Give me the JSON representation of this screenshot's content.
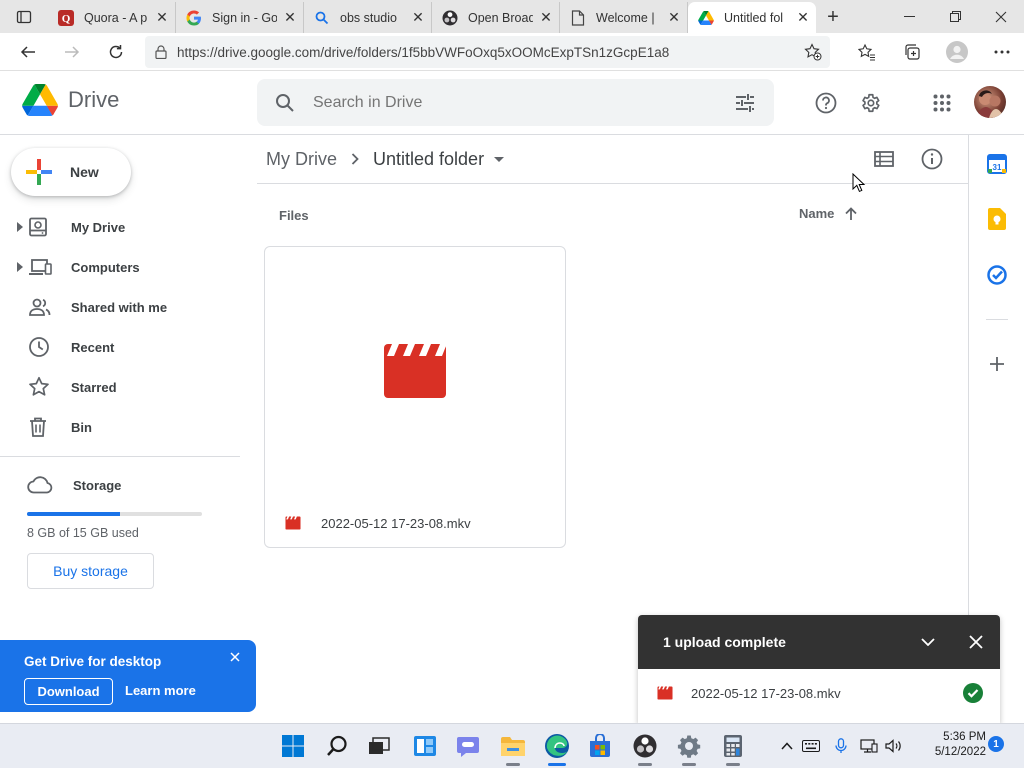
{
  "browser": {
    "tabs": [
      {
        "title": "Quora - A p",
        "icon": "quora-icon"
      },
      {
        "title": "Sign in - Go",
        "icon": "google-icon"
      },
      {
        "title": "obs studio",
        "icon": "search-icon"
      },
      {
        "title": "Open Broad",
        "icon": "obs-icon"
      },
      {
        "title": "Welcome |",
        "icon": "page-icon"
      },
      {
        "title": "Untitled fol",
        "icon": "drive-icon",
        "active": true
      }
    ],
    "url": "https://drive.google.com/drive/folders/1f5bbVWFoOxq5xOOMcExpTSn1zGcpE1a8"
  },
  "drive": {
    "app_name": "Drive",
    "search_placeholder": "Search in Drive",
    "new_label": "New",
    "nav": [
      {
        "label": "My Drive",
        "icon": "my-drive-icon",
        "expandable": true
      },
      {
        "label": "Computers",
        "icon": "computers-icon",
        "expandable": true
      },
      {
        "label": "Shared with me",
        "icon": "shared-icon",
        "expandable": false
      },
      {
        "label": "Recent",
        "icon": "clock-icon",
        "expandable": false
      },
      {
        "label": "Starred",
        "icon": "star-icon",
        "expandable": false
      },
      {
        "label": "Bin",
        "icon": "trash-icon",
        "expandable": false
      }
    ],
    "storage": {
      "label": "Storage",
      "used_text": "8 GB of 15 GB used",
      "used_fraction": 0.53,
      "buy_label": "Buy storage"
    },
    "promo": {
      "title": "Get Drive for desktop",
      "download": "Download",
      "learn_more": "Learn more"
    },
    "breadcrumb": {
      "root": "My Drive",
      "current": "Untitled folder"
    },
    "files_label": "Files",
    "sort_label": "Name",
    "files": [
      {
        "name": "2022-05-12 17-23-08.mkv",
        "type": "video"
      }
    ],
    "upload": {
      "title": "1 upload complete",
      "file": "2022-05-12 17-23-08.mkv"
    }
  },
  "taskbar": {
    "time": "5:36 PM",
    "date": "5/12/2022",
    "notifications": "1"
  },
  "colors": {
    "accent": "#1a73e8",
    "video_red": "#d93025",
    "success": "#188038",
    "toast_bg": "#323232"
  }
}
